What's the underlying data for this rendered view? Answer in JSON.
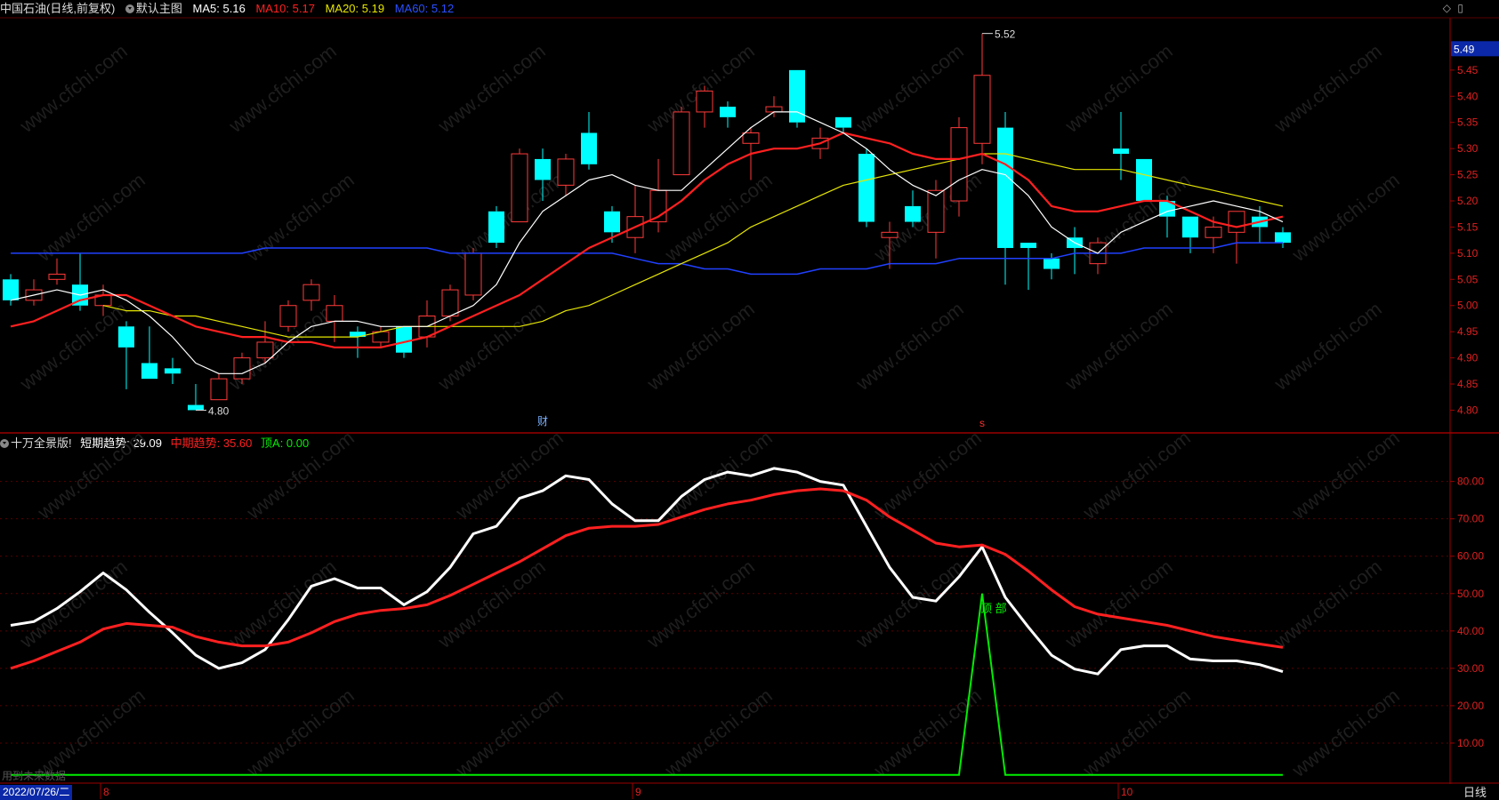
{
  "header": {
    "title": "中国石油(日线,前复权)",
    "template": "默认主图",
    "ma5": "MA5: 5.16",
    "ma10": "MA10: 5.17",
    "ma20": "MA20: 5.19",
    "ma60": "MA60: 5.12",
    "ma5_color": "#ffffff",
    "ma10_color": "#ff2020",
    "ma20_color": "#e6e600",
    "ma60_color": "#2040ff"
  },
  "indicator": {
    "name": "十万全景版!",
    "short": "短期趋势: 29.09",
    "mid": "中期趋势: 35.60",
    "top": "顶A: 0.00",
    "short_color": "#ffffff",
    "mid_color": "#ff2020",
    "top_color": "#00ee00"
  },
  "main_axis": {
    "labels": [
      "5.45",
      "5.40",
      "5.35",
      "5.30",
      "5.25",
      "5.20",
      "5.15",
      "5.10",
      "5.05",
      "5.00",
      "4.95",
      "4.90",
      "4.85",
      "4.80"
    ],
    "current_price": "5.49"
  },
  "sub_axis": {
    "labels": [
      "80.00",
      "70.00",
      "60.00",
      "50.00",
      "40.00",
      "30.00",
      "20.00",
      "10.00"
    ]
  },
  "annotations": {
    "high": "5.52",
    "low": "4.80",
    "fin_marker": "财",
    "s_marker": "s",
    "top_label": "顶 部"
  },
  "footer": {
    "date": "2022/07/26/二",
    "month_8": "8",
    "month_9": "9",
    "month_10": "10",
    "period": "日线",
    "future": "用到未来数据"
  },
  "watermark": "www.cfchi.com",
  "chart_data": {
    "type": "candlestick",
    "main_ylim": [
      4.76,
      5.55
    ],
    "sub_ylim": [
      0,
      88
    ],
    "candles": [
      [
        5.05,
        5.01,
        5.06,
        5.0
      ],
      [
        5.01,
        5.03,
        5.05,
        5.0
      ],
      [
        5.05,
        5.06,
        5.09,
        5.04
      ],
      [
        5.04,
        5.0,
        5.1,
        4.99
      ],
      [
        5.0,
        5.02,
        5.04,
        4.98
      ],
      [
        4.96,
        4.92,
        4.97,
        4.84
      ],
      [
        4.89,
        4.86,
        4.96,
        4.86
      ],
      [
        4.88,
        4.87,
        4.9,
        4.85
      ],
      [
        4.81,
        4.8,
        4.85,
        4.8
      ],
      [
        4.82,
        4.86,
        4.87,
        4.82
      ],
      [
        4.86,
        4.9,
        4.91,
        4.85
      ],
      [
        4.9,
        4.93,
        4.97,
        4.89
      ],
      [
        4.96,
        5.0,
        5.01,
        4.95
      ],
      [
        5.01,
        5.04,
        5.05,
        4.99
      ],
      [
        4.97,
        5.0,
        5.02,
        4.93
      ],
      [
        4.95,
        4.94,
        4.96,
        4.9
      ],
      [
        4.93,
        4.95,
        4.96,
        4.92
      ],
      [
        4.96,
        4.91,
        4.96,
        4.9
      ],
      [
        4.94,
        4.98,
        5.01,
        4.92
      ],
      [
        4.98,
        5.03,
        5.04,
        4.97
      ],
      [
        5.02,
        5.1,
        5.11,
        5.01
      ],
      [
        5.18,
        5.12,
        5.19,
        5.11
      ],
      [
        5.16,
        5.29,
        5.3,
        5.16
      ],
      [
        5.28,
        5.24,
        5.3,
        5.2
      ],
      [
        5.23,
        5.28,
        5.29,
        5.21
      ],
      [
        5.33,
        5.27,
        5.37,
        5.26
      ],
      [
        5.18,
        5.14,
        5.19,
        5.12
      ],
      [
        5.13,
        5.17,
        5.23,
        5.1
      ],
      [
        5.16,
        5.22,
        5.28,
        5.14
      ],
      [
        5.25,
        5.37,
        5.38,
        5.25
      ],
      [
        5.37,
        5.41,
        5.42,
        5.34
      ],
      [
        5.38,
        5.36,
        5.39,
        5.34
      ],
      [
        5.31,
        5.33,
        5.34,
        5.24
      ],
      [
        5.37,
        5.38,
        5.4,
        5.36
      ],
      [
        5.45,
        5.35,
        5.45,
        5.34
      ],
      [
        5.3,
        5.32,
        5.34,
        5.28
      ],
      [
        5.36,
        5.34,
        5.36,
        5.33
      ],
      [
        5.29,
        5.16,
        5.3,
        5.15
      ],
      [
        5.13,
        5.14,
        5.16,
        5.07
      ],
      [
        5.19,
        5.16,
        5.22,
        5.15
      ],
      [
        5.14,
        5.22,
        5.24,
        5.09
      ],
      [
        5.2,
        5.34,
        5.36,
        5.17
      ],
      [
        5.31,
        5.44,
        5.52,
        5.27
      ],
      [
        5.34,
        5.11,
        5.37,
        5.04
      ],
      [
        5.12,
        5.11,
        5.12,
        5.03
      ],
      [
        5.09,
        5.07,
        5.1,
        5.05
      ],
      [
        5.13,
        5.11,
        5.15,
        5.06
      ],
      [
        5.08,
        5.12,
        5.13,
        5.06
      ],
      [
        5.3,
        5.29,
        5.37,
        5.24
      ],
      [
        5.28,
        5.2,
        5.28,
        5.2
      ],
      [
        5.2,
        5.17,
        5.21,
        5.13
      ],
      [
        5.17,
        5.13,
        5.17,
        5.1
      ],
      [
        5.13,
        5.15,
        5.17,
        5.1
      ],
      [
        5.14,
        5.18,
        5.18,
        5.08
      ],
      [
        5.17,
        5.15,
        5.19,
        5.12
      ],
      [
        5.14,
        5.12,
        5.15,
        5.11
      ]
    ],
    "ma5": [
      5.01,
      5.02,
      5.03,
      5.02,
      5.03,
      5.01,
      4.98,
      4.94,
      4.89,
      4.87,
      4.87,
      4.89,
      4.93,
      4.96,
      4.97,
      4.97,
      4.96,
      4.96,
      4.96,
      4.98,
      5.0,
      5.04,
      5.12,
      5.18,
      5.21,
      5.24,
      5.25,
      5.23,
      5.22,
      5.22,
      5.26,
      5.3,
      5.34,
      5.37,
      5.37,
      5.35,
      5.33,
      5.3,
      5.26,
      5.23,
      5.21,
      5.24,
      5.26,
      5.25,
      5.21,
      5.15,
      5.12,
      5.1,
      5.14,
      5.16,
      5.18,
      5.19,
      5.2,
      5.19,
      5.18,
      5.16
    ],
    "ma10": [
      4.96,
      4.97,
      4.99,
      5.01,
      5.02,
      5.02,
      5.0,
      4.98,
      4.96,
      4.95,
      4.94,
      4.94,
      4.93,
      4.93,
      4.92,
      4.92,
      4.92,
      4.93,
      4.94,
      4.96,
      4.98,
      5.0,
      5.02,
      5.05,
      5.08,
      5.11,
      5.13,
      5.15,
      5.17,
      5.2,
      5.24,
      5.27,
      5.29,
      5.3,
      5.3,
      5.31,
      5.33,
      5.32,
      5.31,
      5.29,
      5.28,
      5.28,
      5.29,
      5.27,
      5.24,
      5.19,
      5.18,
      5.18,
      5.19,
      5.2,
      5.2,
      5.18,
      5.16,
      5.15,
      5.16,
      5.17
    ],
    "ma20": [
      5.0,
      4.99,
      4.99,
      4.98,
      4.98,
      4.97,
      4.96,
      4.95,
      4.94,
      4.94,
      4.94,
      4.94,
      4.95,
      4.96,
      4.96,
      4.96,
      4.96,
      4.96,
      4.96,
      4.97,
      4.99,
      5.0,
      5.02,
      5.04,
      5.06,
      5.08,
      5.1,
      5.12,
      5.15,
      5.17,
      5.19,
      5.21,
      5.23,
      5.24,
      5.25,
      5.26,
      5.27,
      5.28,
      5.29,
      5.29,
      5.28,
      5.27,
      5.26,
      5.26,
      5.26,
      5.25,
      5.24,
      5.23,
      5.22,
      5.21,
      5.2,
      5.19
    ],
    "ma60": [
      5.1,
      5.1,
      5.1,
      5.1,
      5.1,
      5.1,
      5.1,
      5.1,
      5.1,
      5.1,
      5.1,
      5.11,
      5.11,
      5.11,
      5.11,
      5.11,
      5.11,
      5.11,
      5.11,
      5.1,
      5.1,
      5.1,
      5.1,
      5.1,
      5.1,
      5.1,
      5.1,
      5.09,
      5.08,
      5.08,
      5.07,
      5.07,
      5.06,
      5.06,
      5.06,
      5.07,
      5.07,
      5.07,
      5.08,
      5.08,
      5.08,
      5.09,
      5.09,
      5.09,
      5.09,
      5.09,
      5.1,
      5.1,
      5.1,
      5.11,
      5.11,
      5.11,
      5.11,
      5.12,
      5.12,
      5.12
    ],
    "short_trend": [
      41.5,
      42.5,
      46,
      50.5,
      55.5,
      51,
      45,
      39.5,
      33.5,
      30,
      31.5,
      35,
      43,
      52,
      54,
      51.5,
      51.5,
      47,
      50.5,
      57,
      66,
      68,
      75.5,
      77.5,
      81.5,
      80.5,
      74,
      69.5,
      69.5,
      76,
      80.5,
      82.5,
      81.5,
      83.5,
      82.5,
      80,
      79,
      68,
      57,
      49,
      48,
      54.5,
      62.5,
      49,
      41,
      33.5,
      29.8,
      28.5,
      35,
      36,
      36,
      32.5,
      32,
      32,
      31,
      29.1
    ],
    "mid_trend": [
      30,
      32,
      34.5,
      37,
      40.5,
      42,
      41.5,
      41,
      38.5,
      37,
      36,
      36,
      37,
      39.5,
      42.5,
      44.5,
      45.5,
      46,
      47,
      49.5,
      52.5,
      55.5,
      58.5,
      62,
      65.5,
      67.5,
      68,
      68,
      68.5,
      70.5,
      72.5,
      74,
      75,
      76.5,
      77.5,
      78,
      77.5,
      75,
      70.5,
      67,
      63.5,
      62.5,
      63,
      60.5,
      56,
      51,
      46.5,
      44.5,
      43.5,
      42.5,
      41.5,
      40,
      38.5,
      37.5,
      36.5,
      35.6
    ],
    "top_signal": [
      0,
      0,
      0,
      0,
      0,
      0,
      0,
      0,
      0,
      0,
      0,
      0,
      0,
      0,
      0,
      0,
      0,
      0,
      0,
      0,
      0,
      0,
      0,
      0,
      0,
      0,
      0,
      0,
      0,
      0,
      0,
      0,
      0,
      0,
      0,
      0,
      0,
      0,
      0,
      0,
      0,
      0,
      50,
      0,
      0,
      0,
      0,
      0,
      0,
      0,
      0,
      0,
      0,
      0,
      0,
      0
    ]
  }
}
